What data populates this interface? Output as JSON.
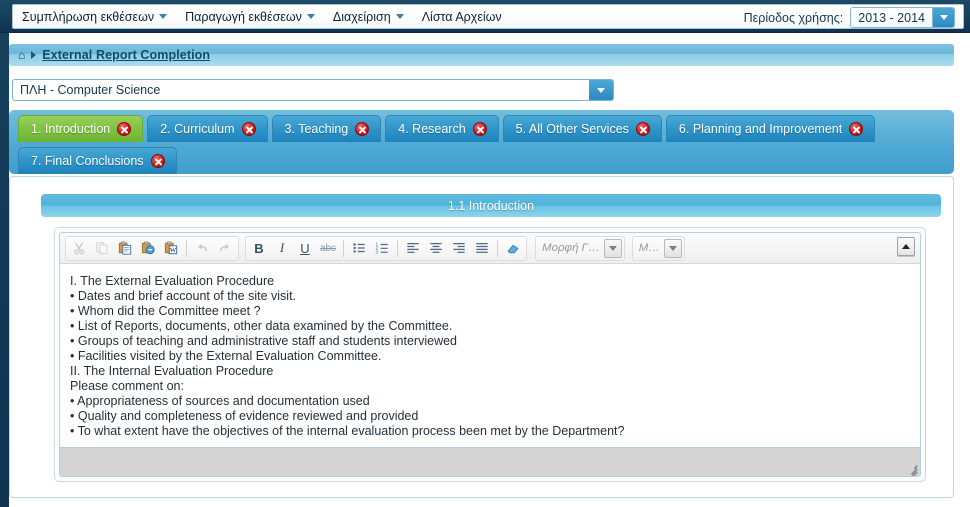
{
  "menubar": {
    "items": [
      {
        "label": "Συμπλήρωση εκθέσεων",
        "has_caret": true
      },
      {
        "label": "Παραγωγή εκθέσεων",
        "has_caret": true
      },
      {
        "label": "Διαχείριση",
        "has_caret": true
      },
      {
        "label": "Λίστα Αρχείων",
        "has_caret": false
      }
    ],
    "period_label": "Περίοδος χρήσης:",
    "period_value": "2013 - 2014"
  },
  "breadcrumb": {
    "home_icon": "home-icon",
    "link": "External Report Completion"
  },
  "department": {
    "value": "ΠΛΗ - Computer Science"
  },
  "tabs": {
    "row1": [
      {
        "label": "1. Introduction",
        "active": true
      },
      {
        "label": "2. Curriculum",
        "active": false
      },
      {
        "label": "3. Teaching",
        "active": false
      },
      {
        "label": "4. Research",
        "active": false
      },
      {
        "label": "5. All Other Services",
        "active": false
      },
      {
        "label": "6. Planning and Improvement",
        "active": false
      }
    ],
    "row2": [
      {
        "label": "7. Final Conclusions",
        "active": false
      }
    ],
    "close_icon": "close-icon"
  },
  "section": {
    "title": "1.1 Introduction"
  },
  "editor": {
    "toolbar": {
      "cut": "cut-icon",
      "copy": "copy-icon",
      "paste": "paste-icon",
      "paste_text": "paste-as-plain-text-icon",
      "paste_word": "paste-from-word-icon",
      "undo": "undo-icon",
      "redo": "redo-icon",
      "bold": "B",
      "italic": "I",
      "underline": "U",
      "strike": "abc",
      "bullet_list": "bulleted-list-icon",
      "numbered_list": "numbered-list-icon",
      "align_left": "align-left-icon",
      "align_center": "align-center-icon",
      "align_right": "align-right-icon",
      "justify": "justify-icon",
      "remove_format": "remove-format-icon",
      "format_dropdown": "Μορφή Γ…",
      "font_dropdown": "Μ…",
      "collapse": "collapse-toolbar-icon"
    },
    "content_lines": [
      "I. The External Evaluation Procedure",
      "• Dates and brief account of the site visit.",
      "• Whom did the Committee meet ?",
      "• List of Reports, documents, other data examined by the Committee.",
      "• Groups of teaching and administrative staff and students interviewed",
      "• Facilities visited by the External Evaluation Committee.",
      "II. The Internal Evaluation Procedure",
      "Please comment on:",
      "• Appropriateness of sources and documentation used",
      "• Quality and completeness of evidence reviewed and provided",
      "• To what extent have the objectives of the internal evaluation process been met by the Department?"
    ],
    "resize_grip": "resize-grip-icon"
  },
  "colors": {
    "menubar_dark": "#16405c",
    "tab_active_green": "#7fc242",
    "tab_inactive_blue": "#2f95c9",
    "section_header_blue": "#4fb2da",
    "close_red": "#d01a1a"
  }
}
